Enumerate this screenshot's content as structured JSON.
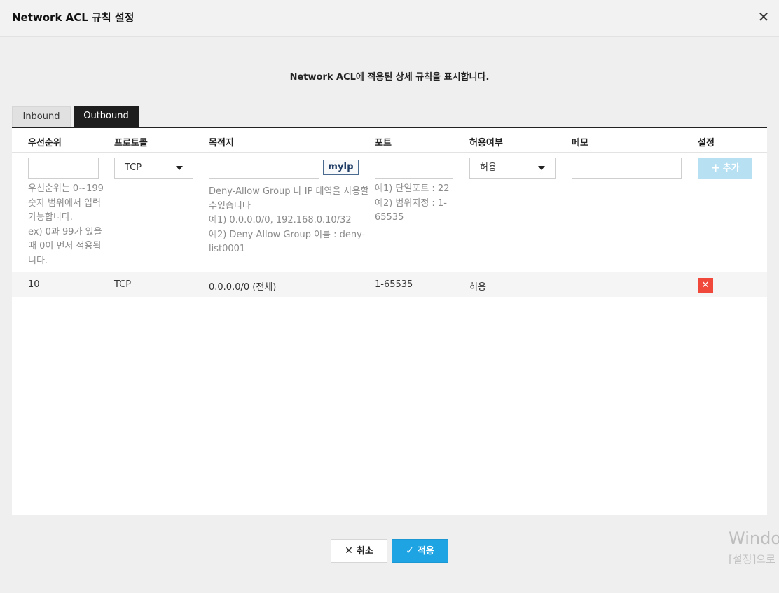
{
  "dialog": {
    "title": "Network ACL 규칙 설정",
    "close_icon": "✕",
    "description": "Network ACL에 적용된 상세 규칙을 표시합니다."
  },
  "tabs": [
    {
      "label": "Inbound",
      "active": false
    },
    {
      "label": "Outbound",
      "active": true
    }
  ],
  "table": {
    "headers": {
      "priority": "우선순위",
      "protocol": "프로토콜",
      "destination": "목적지",
      "port": "포트",
      "allow": "허용여부",
      "memo": "메모",
      "settings": "설정"
    },
    "new_rule": {
      "priority_value": "",
      "protocol_value": "TCP",
      "destination_value": "",
      "myip_label": "myIp",
      "port_value": "",
      "allow_value": "허용",
      "memo_value": "",
      "add_label": "추가",
      "add_icon": "+"
    },
    "help": {
      "priority": [
        "우선순위는 0~199",
        "숫자 범위에서 입력",
        "가능합니다.",
        "ex) 0과 99가 있을",
        "때 0이 먼저 적용됩",
        "니다."
      ],
      "destination": [
        "Deny-Allow Group 나 IP 대역을 사용할",
        "수있습니다",
        "예1) 0.0.0.0/0, 192.168.0.10/32",
        "예2) Deny-Allow Group 이름 : deny-",
        "list0001"
      ],
      "port": [
        "예1) 단일포트 : 22",
        "예2) 범위지정 : 1-",
        "65535"
      ]
    },
    "rows": [
      {
        "priority": "10",
        "protocol": "TCP",
        "destination": "0.0.0.0/0 (전체)",
        "port": "1-65535",
        "allow": "허용",
        "memo": "",
        "delete_icon": "✕"
      }
    ]
  },
  "footer": {
    "cancel_label": "취소",
    "cancel_icon": "✕",
    "apply_label": "적용",
    "apply_icon": "✓"
  },
  "watermark": {
    "line1": "Windo",
    "line2": "[설정]으로"
  },
  "colors": {
    "apply": "#1ea4e3",
    "add_disabled": "#b7e1f3",
    "delete": "#f0493b",
    "tab_active": "#1e1e1e"
  }
}
